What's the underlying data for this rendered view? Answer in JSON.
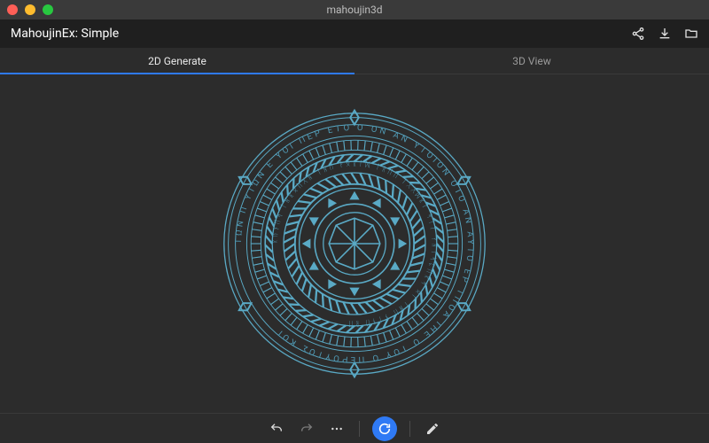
{
  "window": {
    "title": "mahoujin3d"
  },
  "header": {
    "title": "MahoujinEx: Simple",
    "actions": {
      "share": "Share",
      "export": "Export",
      "open": "Open"
    }
  },
  "tabs": {
    "active_index": 0,
    "items": [
      {
        "label": "2D Generate"
      },
      {
        "label": "3D View"
      }
    ]
  },
  "canvas": {
    "accent_color": "#5aaac6",
    "glyph_ring_outer": "ΤΩΝ Π ΥΤΩΝ Ε ΥΟΙ ΠΕΡ ΕΤΟ Ο ΟΝ ΑΝ ΥΤΟΙΟΝ ΟΤΟ ΑΝ ΑΥΤΟ ΕΡ ΤΠΟΑ ΙΗΕ Ο ΤΟΥ Ο ΠΕΡΟΥΤΟΣ ΚΟΙ",
    "glyph_ring_inner": "ᚱᚢᚾᛖᛋ ᛏᚺᚱᛟᚢᚷᚺ ᛏᚺᛖ ᚹᛟᚱᛚᛞ ᛏᚱᛖᛖ ᛉᚷᚷᛞᚱᚨ ᛋᛁᛚ ᚹᚺᛁᛋᛈᛖᚱᛋ ᛟᚠ ᛏᚺᛖ ᚾᛁᚾᛖ ᚱᛖ"
  },
  "toolbar": {
    "undo": "Undo",
    "redo": "Redo",
    "more": "More",
    "regen": "Regenerate",
    "edit": "Edit"
  }
}
